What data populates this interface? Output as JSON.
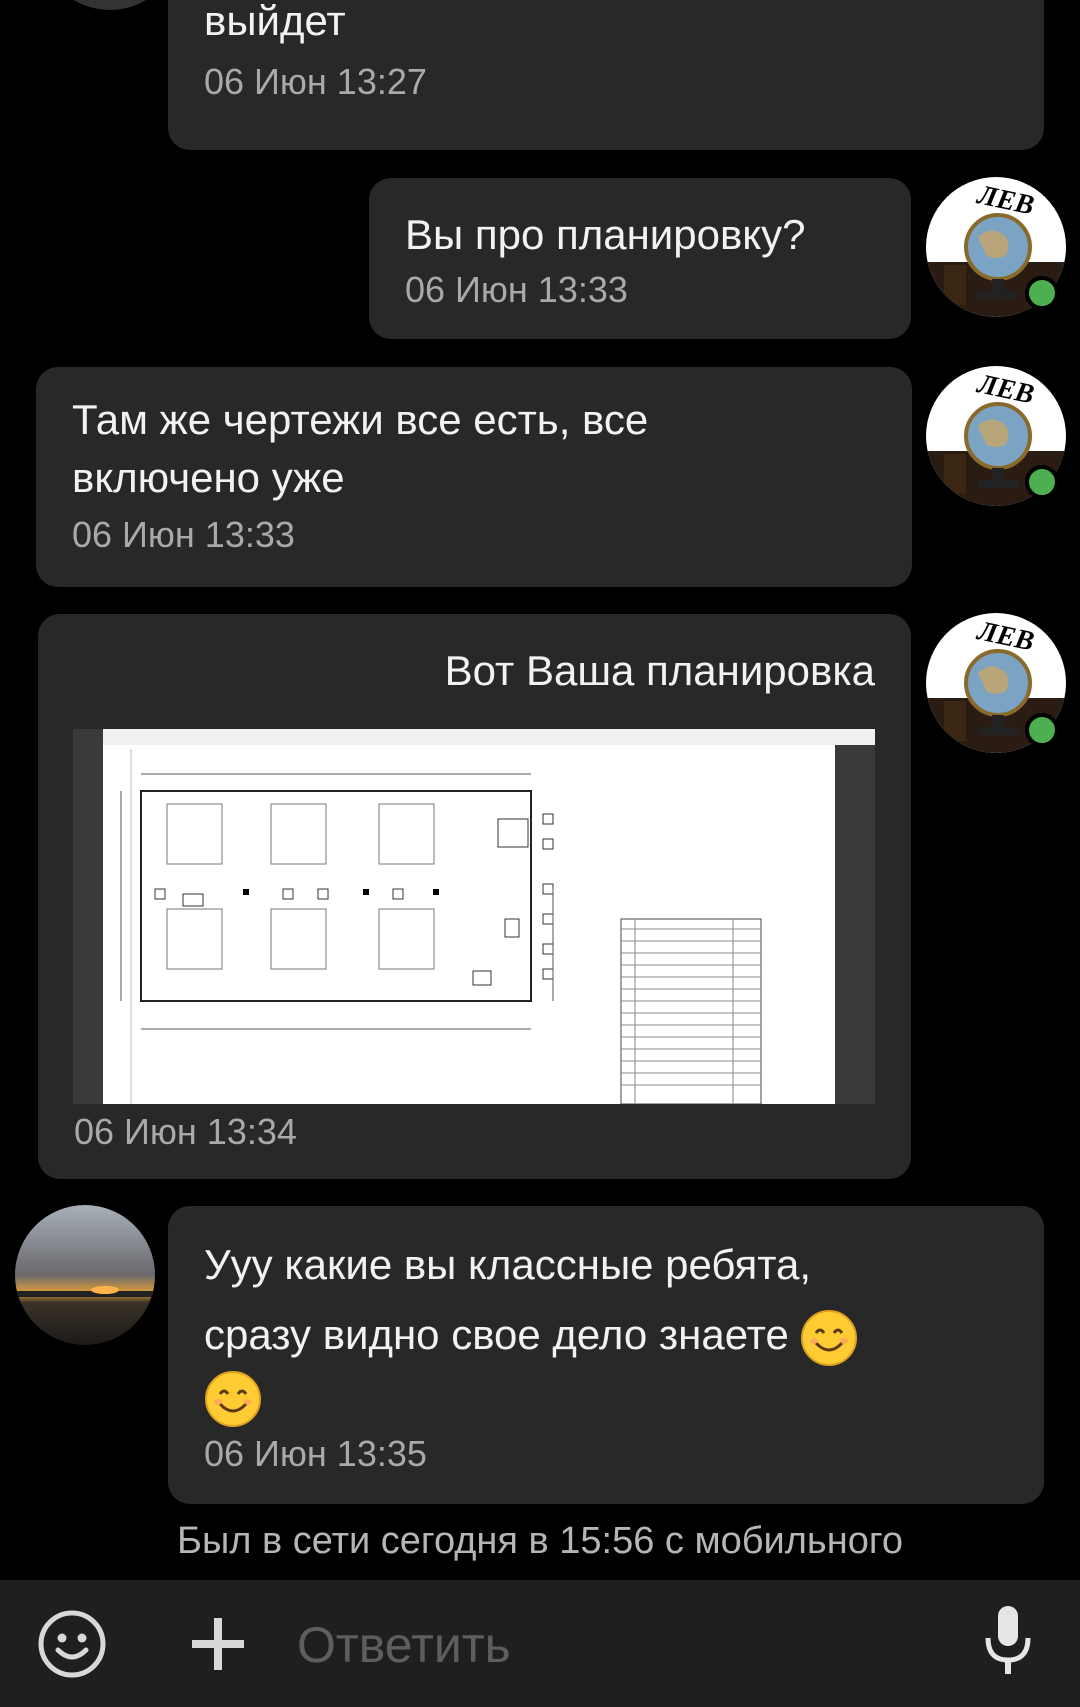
{
  "messages": [
    {
      "text_top": "выйдет",
      "time": "06 Июн 13:27"
    },
    {
      "text": "Вы про планировку?",
      "time": "06 Июн 13:33"
    },
    {
      "text_line1": "Там же чертежи все есть, все",
      "text_line2": "включено уже",
      "time": "06 Июн 13:33"
    },
    {
      "text": "Вот Ваша планировка",
      "time": "06 Июн 13:34"
    },
    {
      "text_line1": "Ууу какие вы классные ребята,",
      "text_line2": "сразу видно свое дело знаете",
      "time": "06 Июн 13:35"
    }
  ],
  "avatar_label": "ЛЕВ",
  "status": "Был в сети сегодня в 15:56 с мобильного",
  "composer": {
    "placeholder": "Ответить"
  },
  "icons": {
    "emoji_button": "smiley-icon",
    "attach_button": "plus-icon",
    "voice_button": "microphone-icon",
    "inline_emoji": "smiling-face-emoji"
  },
  "colors": {
    "bubble": "#282828",
    "background": "#000000",
    "online": "#4caf50",
    "time": "#a9a9a9"
  }
}
